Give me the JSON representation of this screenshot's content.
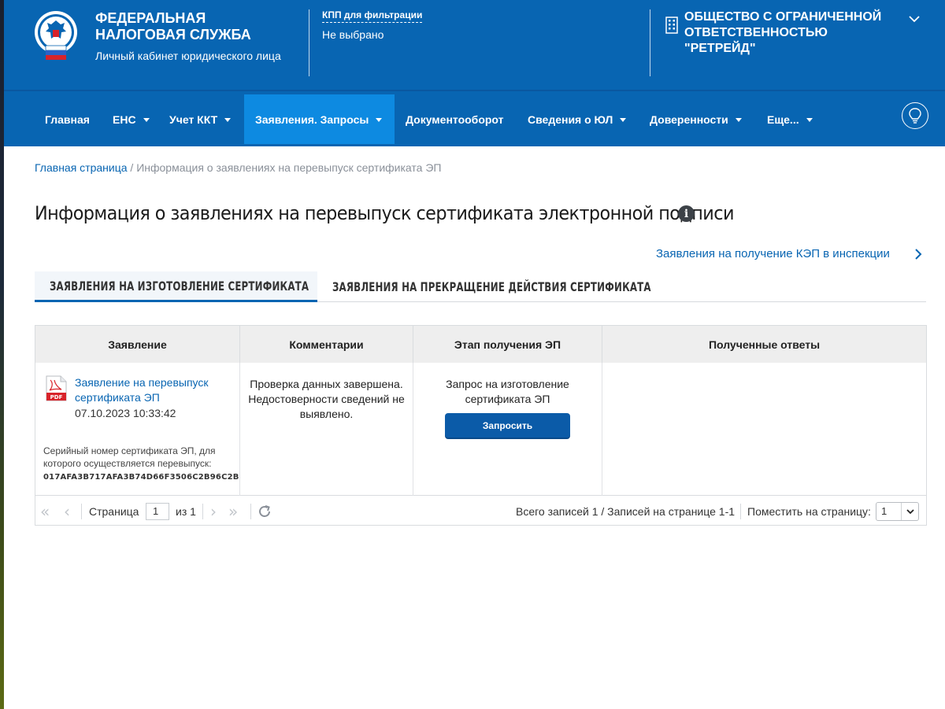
{
  "header": {
    "brand_line1": "ФЕДЕРАЛЬНАЯ",
    "brand_line2": "НАЛОГОВАЯ СЛУЖБА",
    "brand_sub": "Личный кабинет юридического лица",
    "kpp_label": "КПП для фильтрации",
    "kpp_value": "Не выбрано",
    "org_line1": "ОБЩЕСТВО С ОГРАНИЧЕННОЙ",
    "org_line2": "ОТВЕТСТВЕННОСТЬЮ \"РЕТРЕЙД\""
  },
  "nav": {
    "items": [
      {
        "label": "Главная",
        "dropdown": false,
        "active": false
      },
      {
        "label": "ЕНС",
        "dropdown": true,
        "active": false
      },
      {
        "label": "Учет ККТ",
        "dropdown": true,
        "active": false
      },
      {
        "label": "Заявления. Запросы",
        "dropdown": true,
        "active": true
      },
      {
        "label": "Документооборот",
        "dropdown": false,
        "active": false
      },
      {
        "label": "Сведения о ЮЛ",
        "dropdown": true,
        "active": false
      },
      {
        "label": "Доверенности",
        "dropdown": true,
        "active": false
      },
      {
        "label": "Еще...",
        "dropdown": true,
        "active": false
      }
    ]
  },
  "breadcrumb": {
    "home": "Главная страница",
    "separator": " / ",
    "current": "Информация о заявлениях на перевыпуск сертификата ЭП"
  },
  "page": {
    "title": "Информация о заявлениях на перевыпуск сертификата электронной подписи",
    "kep_link": "Заявления на получение КЭП в инспекции"
  },
  "tabs": [
    {
      "label": "ЗАЯВЛЕНИЯ НА ИЗГОТОВЛЕНИЕ СЕРТИФИКАТА",
      "active": true
    },
    {
      "label": "ЗАЯВЛЕНИЯ НА ПРЕКРАЩЕНИЕ ДЕЙСТВИЯ СЕРТИФИКАТА",
      "active": false
    }
  ],
  "table": {
    "columns": [
      "Заявление",
      "Комментарии",
      "Этап получения ЭП",
      "Полученные ответы"
    ],
    "rows": [
      {
        "application_title": "Заявление на перевыпуск сертификата ЭП",
        "application_date": "07.10.2023 10:33:42",
        "serial_label": "Серийный номер сертификата ЭП, для которого осуществляется перевыпуск:",
        "serial_value": "017AFA3B717AFA3B74D66F3506C2B96C2B",
        "comment": "Проверка данных завершена. Недостоверности сведений не выявлено.",
        "stage": "Запрос на изготовление сертификата ЭП",
        "stage_button": "Запросить",
        "answers": ""
      }
    ]
  },
  "pager": {
    "page_label": "Страница",
    "page_value": "1",
    "of_label": "из 1",
    "summary": "Всего записей 1 / Записей на странице 1-1",
    "per_page_label": "Поместить на страницу:",
    "per_page_value": "1"
  },
  "colors": {
    "brand_blue": "#0865b2",
    "active_nav": "#0d8ae1",
    "button_blue": "#0b5ba8"
  }
}
